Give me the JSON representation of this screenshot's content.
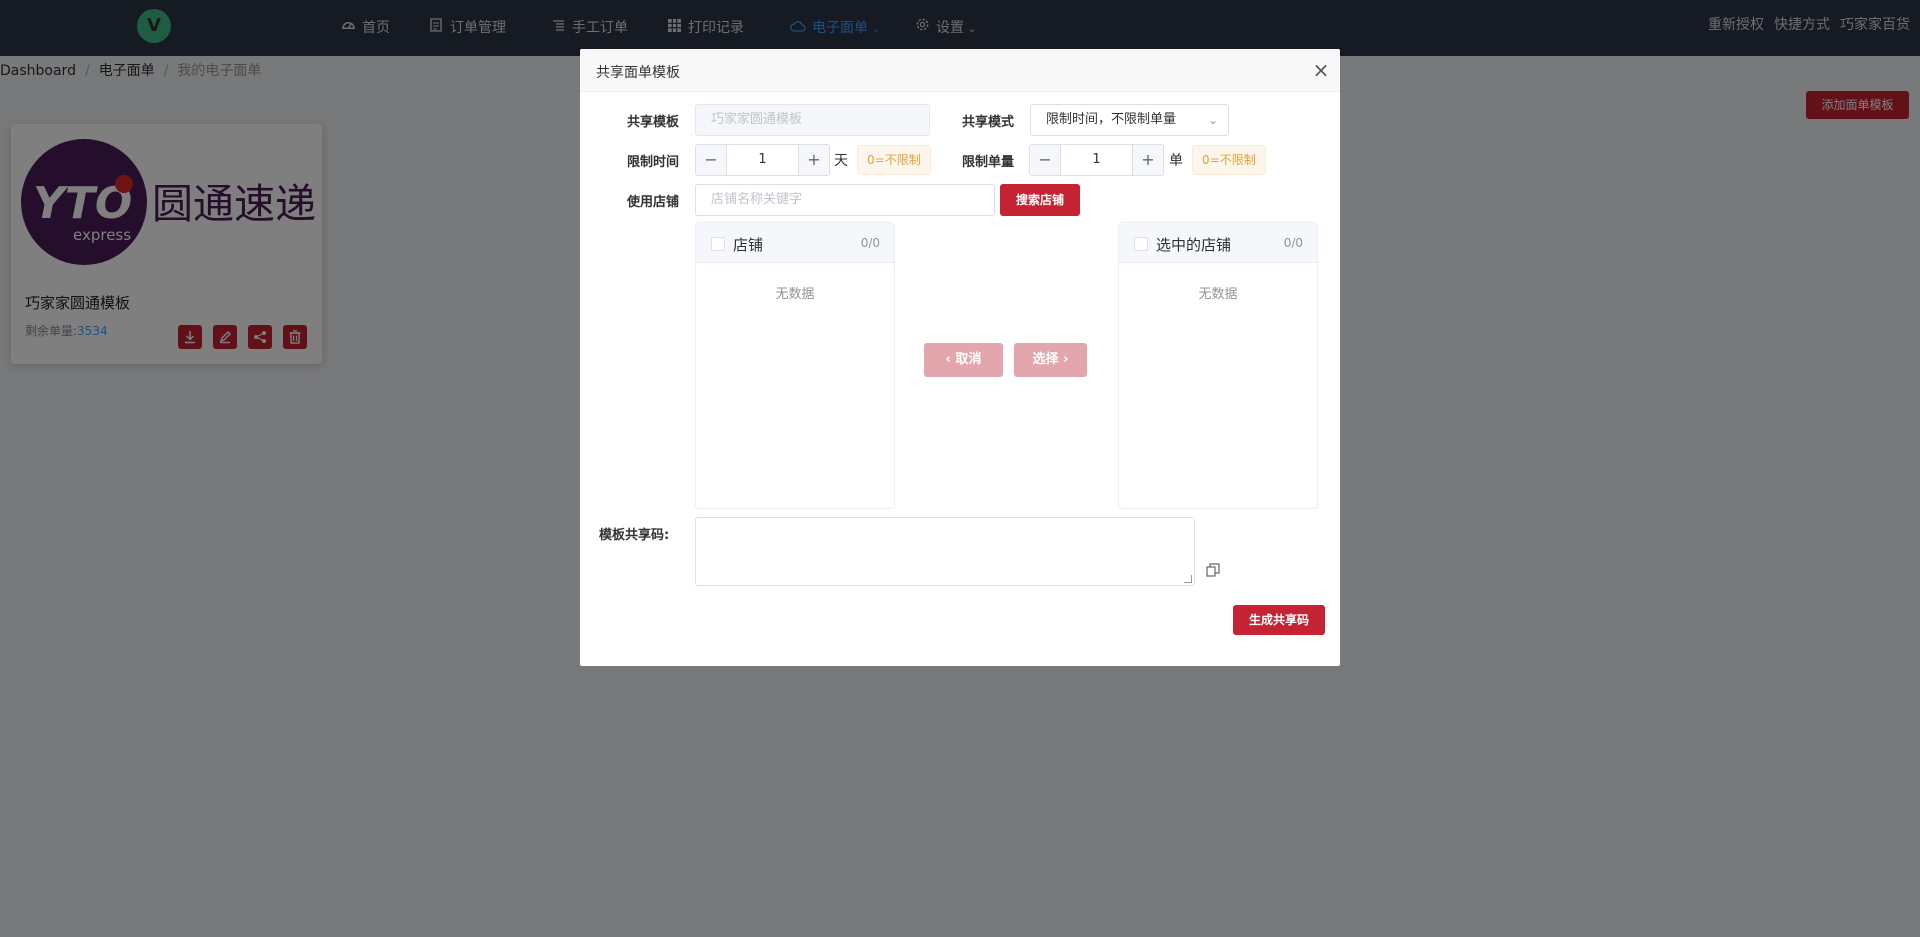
{
  "nav": {
    "items": [
      {
        "label": "首页",
        "icon": "dashboard-icon"
      },
      {
        "label": "订单管理",
        "icon": "document-icon"
      },
      {
        "label": "手工订单",
        "icon": "list-icon"
      },
      {
        "label": "打印记录",
        "icon": "grid-icon"
      },
      {
        "label": "电子面单",
        "icon": "cloud-icon"
      },
      {
        "label": "设置",
        "icon": "gear-icon"
      }
    ],
    "right": {
      "reauth": "重新授权",
      "shortcut": "快捷方式",
      "store": "巧家家百货"
    },
    "active_color": "#409eff"
  },
  "breadcrumb": {
    "items": [
      "Dashboard",
      "电子面单",
      "我的电子面单"
    ],
    "separator": "/"
  },
  "page": {
    "add_button": "添加面单模板"
  },
  "card": {
    "brand_name": "圆通速递",
    "brand_logo_text": "YTO",
    "brand_logo_sub": "express",
    "title": "巧家家圆通模板",
    "remain_label": "剩余单量:",
    "remain_value": "3534",
    "actions": [
      "download-icon",
      "edit-icon",
      "share-icon",
      "delete-icon"
    ]
  },
  "dialog": {
    "title": "共享面单模板",
    "template": {
      "label": "共享模板",
      "value": "巧家家圆通模板"
    },
    "mode": {
      "label": "共享模式",
      "value": "限制时间，不限制单量"
    },
    "time_limit": {
      "label": "限制时间",
      "value": "1",
      "unit": "天",
      "hint": "0=不限制"
    },
    "count_limit": {
      "label": "限制单量",
      "value": "1",
      "unit": "单",
      "hint": "0=不限制"
    },
    "store": {
      "label": "使用店铺",
      "placeholder": "店铺名称关键字",
      "search_button": "搜索店铺"
    },
    "transfer": {
      "left": {
        "title": "店铺",
        "count": "0/0",
        "empty": "无数据"
      },
      "right": {
        "title": "选中的店铺",
        "count": "0/0",
        "empty": "无数据"
      },
      "cancel": "取消",
      "select": "选择"
    },
    "share_code": {
      "label": "模板共享码:",
      "value": ""
    },
    "generate_button": "生成共享码"
  },
  "colors": {
    "primary_red": "#c52233",
    "nav_bg": "#2a3447",
    "hint_orange": "#e6a23c"
  }
}
